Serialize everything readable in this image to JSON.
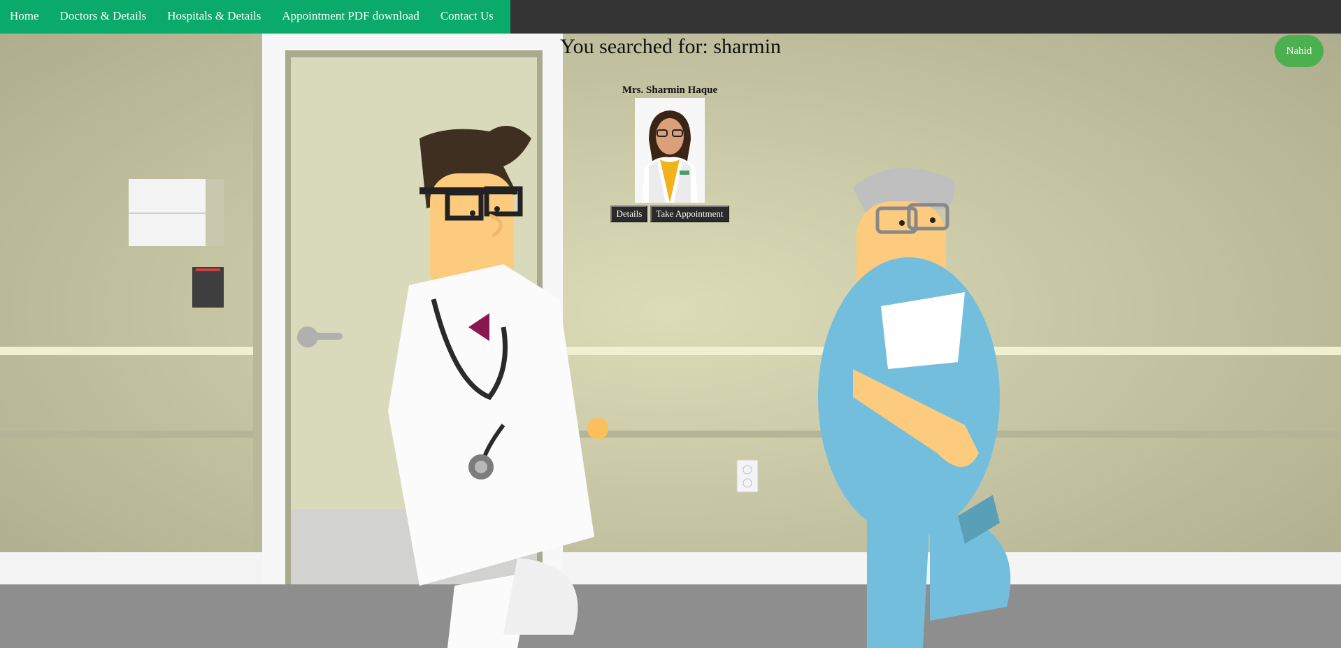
{
  "nav": {
    "items": [
      {
        "label": "Home"
      },
      {
        "label": "Doctors & Details"
      },
      {
        "label": "Hospitals & Details"
      },
      {
        "label": "Appointment PDF download"
      },
      {
        "label": "Contact Us"
      }
    ]
  },
  "search": {
    "title": "You searched for: sharmin"
  },
  "results": [
    {
      "name": "Mrs. Sharmin Haque",
      "details_label": "Details",
      "appointment_label": "Take Appointment"
    }
  ],
  "user": {
    "name": "Nahid"
  },
  "colors": {
    "nav_bg": "#343434",
    "nav_menu_bg": "#0aaa6a",
    "user_badge": "#4caf50",
    "button_bg": "#2a2a2a"
  }
}
